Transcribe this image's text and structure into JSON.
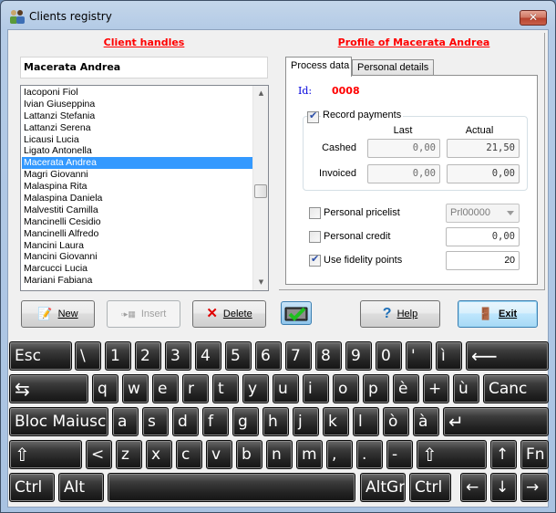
{
  "window": {
    "title": "Clients registry",
    "icon": "users-icon",
    "close_label": "✕"
  },
  "left": {
    "section_title": "Client handles",
    "name_value": "Macerata Andrea",
    "clients": [
      "Iacoponi Fiol",
      "Ivian Giuseppina",
      "Lattanzi Stefania",
      "Lattanzi Serena",
      "Licausi Lucia",
      "Ligato Antonella",
      "Macerata Andrea",
      "Magri Giovanni",
      "Malaspina Rita",
      "Malaspina Daniela",
      "Malvestiti Camilla",
      "Mancinelli Cesidio",
      "Mancinelli Alfredo",
      "Mancini Laura",
      "Mancini Giovanni",
      "Marcucci Lucia",
      "Mariani Fabiana"
    ],
    "selected_index": 6
  },
  "right": {
    "section_title": "Profile of Macerata Andrea",
    "tabs": [
      {
        "label": "Process data",
        "active": true
      },
      {
        "label": "Personal details",
        "active": false
      }
    ],
    "id_label": "Id:",
    "id_value": "0008",
    "record_payments": {
      "label": "Record payments",
      "checked": true
    },
    "col_last": "Last",
    "col_actual": "Actual",
    "rows": [
      {
        "label": "Cashed",
        "last": "0,00",
        "actual": "21,50"
      },
      {
        "label": "Invoiced",
        "last": "0,00",
        "actual": "0,00"
      }
    ],
    "personal_pricelist": {
      "label": "Personal pricelist",
      "checked": false,
      "value": "Prl00000"
    },
    "personal_credit": {
      "label": "Personal credit",
      "checked": false,
      "value": "0,00"
    },
    "fidelity_points": {
      "label": "Use fidelity points",
      "checked": true,
      "value": "20"
    }
  },
  "buttons": {
    "new": {
      "label": "New",
      "icon": "edit-icon",
      "enabled": true
    },
    "insert": {
      "label": "Insert",
      "icon": "insert-icon",
      "enabled": false
    },
    "delete": {
      "label": "Delete",
      "icon": "delete-icon",
      "enabled": true
    },
    "keyboard_toggle": {
      "icon": "keyboard-check-icon",
      "pressed": true
    },
    "help": {
      "label": "Help",
      "icon": "help-icon",
      "enabled": true
    },
    "exit": {
      "label": "Exit",
      "icon": "exit-door-icon",
      "enabled": true
    }
  },
  "keyboard": {
    "rows": [
      [
        "Esc",
        "\\",
        "1",
        "2",
        "3",
        "4",
        "5",
        "6",
        "7",
        "8",
        "9",
        "0",
        "'",
        "ì",
        "⟵"
      ],
      [
        "⇆",
        "q",
        "w",
        "e",
        "r",
        "t",
        "y",
        "u",
        "i",
        "o",
        "p",
        "è",
        "+",
        "ù",
        "Canc"
      ],
      [
        "Bloc Maiusc",
        "a",
        "s",
        "d",
        "f",
        "g",
        "h",
        "j",
        "k",
        "l",
        "ò",
        "à",
        "↵"
      ],
      [
        "⇧",
        "<",
        "z",
        "x",
        "c",
        "v",
        "b",
        "n",
        "m",
        ",",
        ".",
        "-",
        "⇧",
        "↑",
        "Fn"
      ],
      [
        "Ctrl",
        "Alt",
        "",
        "AltGr",
        "Ctrl",
        "←",
        "↓",
        "→"
      ]
    ]
  }
}
